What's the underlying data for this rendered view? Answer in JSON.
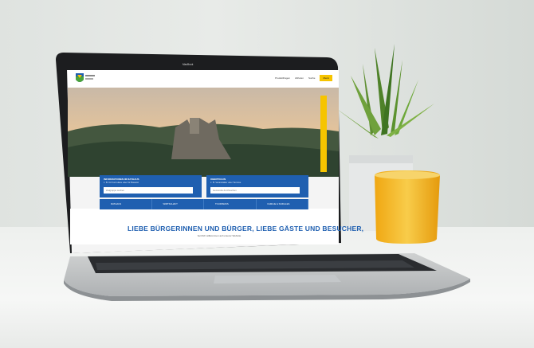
{
  "screen": {
    "camera_label": "MacBook",
    "nav": {
      "item1": "Produktfragen",
      "item2": "Abholen",
      "item3": "Suche",
      "menu": "Menü"
    },
    "panels": [
      {
        "title": "INFORMATIONEN IM RATHAUS",
        "subtitle": "z. B. für Formulare oder für Bauamt",
        "placeholder": "Zielgruppe suchen"
      },
      {
        "title": "OBERTRAUN",
        "subtitle": "z. B. Veranstalter oder Termine",
        "placeholder": "Gemeinde durchsuchen"
      }
    ],
    "quicklinks": [
      "RATHAUS",
      "WIRTSCHAFT",
      "TOURISMUS",
      "FAMILIE & SOZIALES"
    ],
    "headline": "LIEBE BÜRGERINNEN UND BÜRGER, LIEBE GÄSTE UND BESUCHER,",
    "subline": "herzlich willkommen auf unserer Website"
  },
  "colors": {
    "brand_blue": "#1f5fb0",
    "accent_yellow": "#f6c400",
    "mug_yellow": "#f3b21a"
  }
}
